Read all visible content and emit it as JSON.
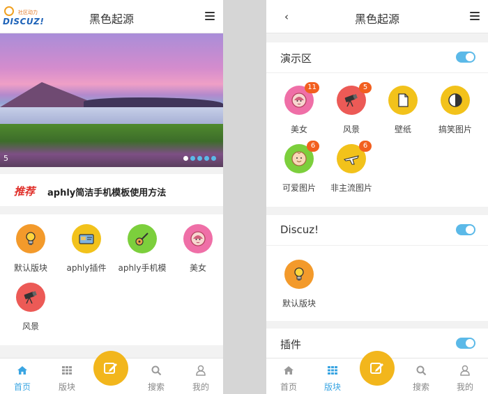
{
  "left": {
    "header": {
      "title": "黑色起源",
      "logo_slogan": "社区动力",
      "logo_text": "DISCUZ!"
    },
    "banner": {
      "counter": "5",
      "dots_total": 5,
      "dots_active_index": 0
    },
    "recommend": {
      "tag": "推荐",
      "text": "aphly简洁手机模板使用方法"
    },
    "forums": [
      {
        "label": "默认版块",
        "icon": "lightbulb-icon",
        "color": "#f39a2b"
      },
      {
        "label": "aphly插件",
        "icon": "card-icon",
        "color": "#f2c21b"
      },
      {
        "label": "aphly手机模",
        "icon": "guitar-icon",
        "color": "#7ccf3c"
      },
      {
        "label": "美女",
        "icon": "woman-icon",
        "color": "#ef6fa7"
      },
      {
        "label": "风景",
        "icon": "telescope-icon",
        "color": "#ec5a56"
      }
    ],
    "tabbar": [
      {
        "label": "首页",
        "icon": "home-icon",
        "active": true
      },
      {
        "label": "版块",
        "icon": "grid-icon",
        "active": false
      },
      {
        "label": "搜索",
        "icon": "search-icon",
        "active": false
      },
      {
        "label": "我的",
        "icon": "user-icon",
        "active": false
      }
    ]
  },
  "right": {
    "header": {
      "title": "黑色起源"
    },
    "sections": [
      {
        "name": "演示区",
        "toggle_on": true,
        "forums": [
          {
            "label": "美女",
            "badge": "11",
            "icon": "woman-icon",
            "color": "#ef6fa7"
          },
          {
            "label": "风景",
            "badge": "5",
            "icon": "telescope-icon",
            "color": "#ec5a56"
          },
          {
            "label": "壁纸",
            "badge": "",
            "icon": "document-icon",
            "color": "#f2c21b"
          },
          {
            "label": "搞笑图片",
            "badge": "",
            "icon": "contrast-icon",
            "color": "#f2c21b"
          },
          {
            "label": "可爱图片",
            "badge": "6",
            "icon": "baby-icon",
            "color": "#7ccf3c"
          },
          {
            "label": "非主流图片",
            "badge": "6",
            "icon": "airplane-icon",
            "color": "#f2c21b"
          }
        ]
      },
      {
        "name": "Discuz!",
        "toggle_on": true,
        "forums": [
          {
            "label": "默认版块",
            "badge": "",
            "icon": "lightbulb-icon",
            "color": "#f39a2b"
          }
        ]
      },
      {
        "name": "插件",
        "toggle_on": true,
        "forums": []
      }
    ],
    "tabbar": [
      {
        "label": "首页",
        "icon": "home-icon",
        "active": false
      },
      {
        "label": "版块",
        "icon": "grid-icon",
        "active": true
      },
      {
        "label": "搜索",
        "icon": "search-icon",
        "active": false
      },
      {
        "label": "我的",
        "icon": "user-icon",
        "active": false
      }
    ]
  },
  "colors": {
    "accent": "#5bb9e8",
    "tab_active": "#3aa5e2",
    "fab": "#f2b61c",
    "badge": "#f25f1f",
    "recommend_tag": "#e0302a"
  }
}
